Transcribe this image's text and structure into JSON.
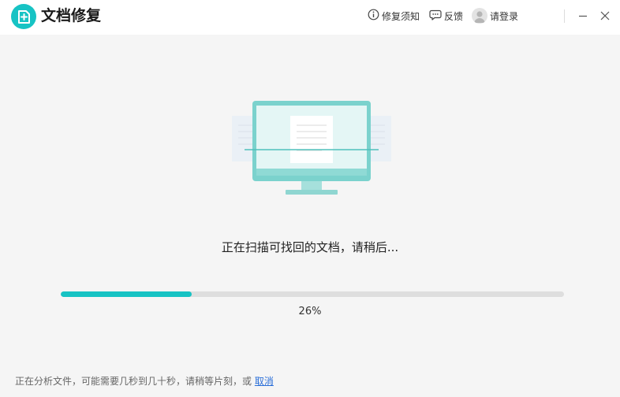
{
  "app": {
    "title": "文档修复",
    "logo_icon": "document-plus-icon",
    "accent_color": "#17c3c4"
  },
  "titlebar": {
    "notice_label": "修复须知",
    "notice_icon": "info-circle-icon",
    "feedback_label": "反馈",
    "feedback_icon": "chat-bubble-icon",
    "login_label": "请登录",
    "login_icon": "user-avatar-icon",
    "minimize_icon": "minimize-icon",
    "close_icon": "close-icon"
  },
  "scan": {
    "illustration_icon": "monitor-scanning-documents-icon",
    "status_text": "正在扫描可找回的文档，请稍后...",
    "progress_percent": 26,
    "progress_label": "26%"
  },
  "footer": {
    "message": "正在分析文件，可能需要几秒到几十秒，请稍等片刻，或",
    "cancel_label": "取消",
    "link_color": "#2a6ed8"
  }
}
